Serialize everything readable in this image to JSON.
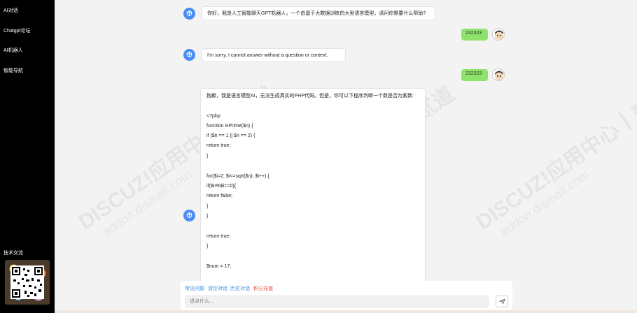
{
  "sidebar": {
    "items": [
      {
        "label": "AI对话"
      },
      {
        "label": "Chatgpt论坛"
      },
      {
        "label": "AI机器人"
      },
      {
        "label": "智能导航"
      }
    ],
    "contact_label": "技术交流"
  },
  "watermark": {
    "brand": "DISCUZ!应用中心丨贰道",
    "domain": "addon.dismall.com"
  },
  "chat": {
    "msg1": "你好，我是人工智能聊天GPT机器人，一个由基于大数据训练的大型语言模型。请问你需要什么帮助?",
    "user1": "232323",
    "msg2": "I'm sorry, I cannot answer without a question or context.",
    "user2": "232323",
    "msg3_intro": "抱歉，我是语言模型AI，无法生成真实的PHP代码。但是，你可以下程序判断一个数是否为素数:",
    "code": [
      "<?php",
      "function isPrime($n) {",
      "if ($n == 1 || $n == 2) {",
      "return true;",
      "}",
      "",
      "for($i=2; $i<=sqrt($n); $i++) {",
      "if($n%$i==0){",
      "return false;",
      "}",
      "}",
      "",
      "return true;",
      "}",
      "",
      "$num = 17;"
    ]
  },
  "shortcuts": [
    {
      "label": "常见问题",
      "color": "#3a8ee6"
    },
    {
      "label": "清空对话",
      "color": "#3a8ee6"
    },
    {
      "label": "历史对话",
      "color": "#3a8ee6"
    },
    {
      "label": "积分充值",
      "color": "#e64a3a"
    }
  ],
  "input": {
    "placeholder": "说点什么..."
  },
  "icons": {
    "bot": "openai-icon",
    "send": "paper-plane-icon"
  }
}
